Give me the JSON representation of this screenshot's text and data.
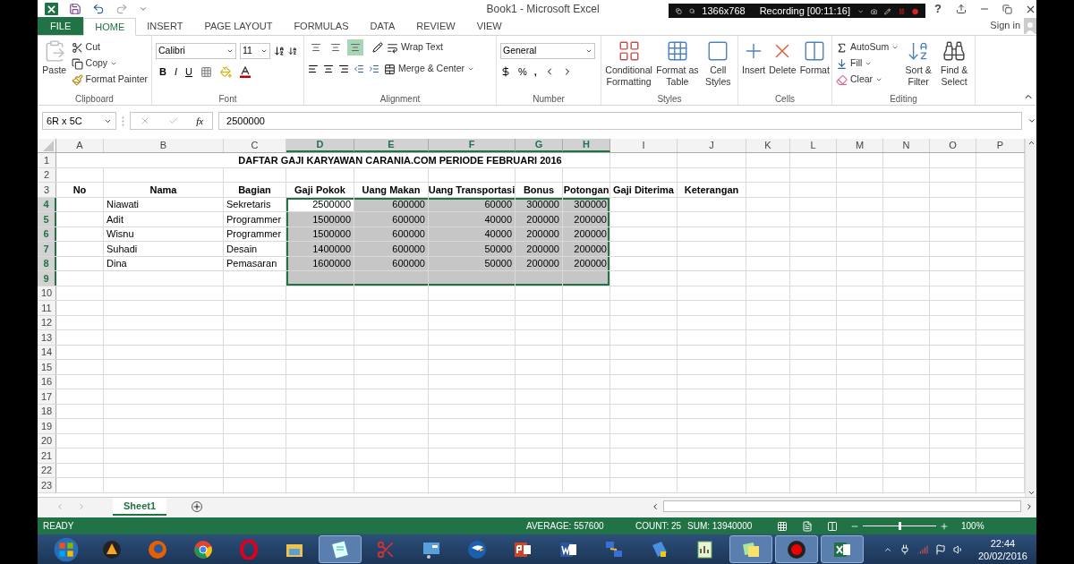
{
  "title_bar": {
    "title": "Book1 - Microsoft Excel",
    "help": "?",
    "sign_in": "Sign in"
  },
  "recorder": {
    "resolution": "1366x768",
    "status": "Recording [00:11:16]"
  },
  "tabs": [
    {
      "label": "FILE",
      "kind": "file",
      "selected": false
    },
    {
      "label": "HOME",
      "kind": "tab",
      "selected": true
    },
    {
      "label": "INSERT",
      "kind": "tab",
      "selected": false
    },
    {
      "label": "PAGE LAYOUT",
      "kind": "tab",
      "selected": false
    },
    {
      "label": "FORMULAS",
      "kind": "tab",
      "selected": false
    },
    {
      "label": "DATA",
      "kind": "tab",
      "selected": false
    },
    {
      "label": "REVIEW",
      "kind": "tab",
      "selected": false
    },
    {
      "label": "VIEW",
      "kind": "tab",
      "selected": false
    }
  ],
  "ribbon": {
    "clipboard": {
      "label": "Clipboard",
      "paste": "Paste",
      "cut": "Cut",
      "copy": "Copy",
      "format_painter": "Format Painter"
    },
    "font": {
      "label": "Font",
      "font_name": "Calibri",
      "font_size": "11",
      "bold": "B",
      "italic": "I",
      "underline": "U"
    },
    "alignment": {
      "label": "Alignment",
      "wrap_text": "Wrap Text",
      "merge_center": "Merge & Center",
      "vertical_align": [
        {
          "selected": false
        },
        {
          "selected": false
        },
        {
          "selected": true
        }
      ]
    },
    "number": {
      "label": "Number",
      "format": "General",
      "percent": "%",
      "comma": ","
    },
    "styles": {
      "label": "Styles",
      "conditional_formatting": [
        "Conditional",
        "Formatting"
      ],
      "format_as_table": [
        "Format as",
        "Table"
      ],
      "cell_styles": [
        "Cell",
        "Styles"
      ]
    },
    "cells": {
      "label": "Cells",
      "insert": "Insert",
      "delete": "Delete",
      "format": "Format"
    },
    "editing": {
      "label": "Editing",
      "autosum": "AutoSum",
      "fill": "Fill",
      "clear": "Clear",
      "sort_filter": [
        "Sort &",
        "Filter"
      ],
      "find_select": [
        "Find &",
        "Select"
      ]
    }
  },
  "formula_bar": {
    "name_box": "6R x 5C",
    "function_label": "fx",
    "value": "2500000"
  },
  "columns": [
    {
      "label": "A",
      "selected": false
    },
    {
      "label": "B",
      "selected": false
    },
    {
      "label": "C",
      "selected": false
    },
    {
      "label": "D",
      "selected": true
    },
    {
      "label": "E",
      "selected": true
    },
    {
      "label": "F",
      "selected": true
    },
    {
      "label": "G",
      "selected": true
    },
    {
      "label": "H",
      "selected": true
    },
    {
      "label": "I",
      "selected": false
    },
    {
      "label": "J",
      "selected": false
    },
    {
      "label": "K",
      "selected": false
    },
    {
      "label": "L",
      "selected": false
    },
    {
      "label": "M",
      "selected": false
    },
    {
      "label": "N",
      "selected": false
    },
    {
      "label": "O",
      "selected": false
    },
    {
      "label": "P",
      "selected": false
    }
  ],
  "rows": [
    {
      "label": "1",
      "kind": "title",
      "selected": false,
      "title": "DAFTAR GAJI KARYAWAN CARANIA.COM PERIODE FEBRUARI 2016"
    },
    {
      "label": "2",
      "kind": "data",
      "selected": false
    },
    {
      "label": "3",
      "kind": "header",
      "selected": false,
      "cells": {
        "A": "No",
        "B": "Nama",
        "C": "Bagian",
        "D": "Gaji Pokok",
        "E": "Uang Makan",
        "F": "Uang Transportasi",
        "G": "Bonus",
        "H": "Potongan",
        "I": "Gaji Diterima",
        "J": "Keterangan"
      }
    },
    {
      "label": "4",
      "kind": "data",
      "selected": true,
      "active": true,
      "cells": {
        "B": "Niawati",
        "C": "Sekretaris",
        "D": "2500000",
        "E": "600000",
        "F": "60000",
        "G": "300000",
        "H": "300000"
      }
    },
    {
      "label": "5",
      "kind": "data",
      "selected": true,
      "cells": {
        "B": "Adit",
        "C": "Programmer",
        "D": "1500000",
        "E": "600000",
        "F": "40000",
        "G": "200000",
        "H": "200000"
      }
    },
    {
      "label": "6",
      "kind": "data",
      "selected": true,
      "cells": {
        "B": "Wisnu",
        "C": "Programmer",
        "D": "1500000",
        "E": "600000",
        "F": "40000",
        "G": "200000",
        "H": "200000"
      }
    },
    {
      "label": "7",
      "kind": "data",
      "selected": true,
      "cells": {
        "B": "Suhadi",
        "C": "Desain",
        "D": "1400000",
        "E": "600000",
        "F": "50000",
        "G": "200000",
        "H": "200000"
      }
    },
    {
      "label": "8",
      "kind": "data",
      "selected": true,
      "cells": {
        "B": "Dina",
        "C": "Pemasaran",
        "D": "1600000",
        "E": "600000",
        "F": "50000",
        "G": "200000",
        "H": "200000"
      }
    },
    {
      "label": "9",
      "kind": "data",
      "selected": true
    },
    {
      "label": "10",
      "kind": "data",
      "selected": false
    },
    {
      "label": "11",
      "kind": "data",
      "selected": false
    },
    {
      "label": "12",
      "kind": "data",
      "selected": false
    },
    {
      "label": "13",
      "kind": "data",
      "selected": false
    },
    {
      "label": "14",
      "kind": "data",
      "selected": false
    },
    {
      "label": "15",
      "kind": "data",
      "selected": false
    },
    {
      "label": "16",
      "kind": "data",
      "selected": false
    },
    {
      "label": "17",
      "kind": "data",
      "selected": false
    },
    {
      "label": "18",
      "kind": "data",
      "selected": false
    },
    {
      "label": "19",
      "kind": "data",
      "selected": false
    },
    {
      "label": "20",
      "kind": "data",
      "selected": false
    },
    {
      "label": "21",
      "kind": "data",
      "selected": false
    },
    {
      "label": "22",
      "kind": "data",
      "selected": false
    },
    {
      "label": "23",
      "kind": "data",
      "selected": false
    }
  ],
  "sheets": [
    {
      "label": "Sheet1",
      "selected": true
    }
  ],
  "status_bar": {
    "mode": "READY",
    "average": "AVERAGE: 557600",
    "count": "COUNT: 25",
    "sum": "SUM: 13940000",
    "zoom": "100%",
    "zoom_level": {
      "level": 0.5
    }
  },
  "taskbar": {
    "apps": [
      {
        "kind": "orb",
        "open": false
      },
      {
        "kind": "triangle",
        "open": false
      },
      {
        "kind": "fox",
        "open": false
      },
      {
        "kind": "wheel",
        "open": false
      },
      {
        "kind": "ring",
        "open": false
      },
      {
        "kind": "folder",
        "open": false
      },
      {
        "kind": "notepad",
        "open": true
      },
      {
        "kind": "scissors",
        "open": false
      },
      {
        "kind": "panel",
        "open": false
      },
      {
        "kind": "eagle",
        "open": false
      },
      {
        "kind": "slides",
        "open": false
      },
      {
        "kind": "doc",
        "open": false
      },
      {
        "kind": "network",
        "open": false
      },
      {
        "kind": "book",
        "open": false
      },
      {
        "kind": "chart",
        "open": false
      },
      {
        "kind": "notes",
        "open": true
      },
      {
        "kind": "record",
        "open": true
      },
      {
        "kind": "sheet",
        "open": true
      }
    ],
    "time": "22:44",
    "date": "20/02/2016"
  }
}
